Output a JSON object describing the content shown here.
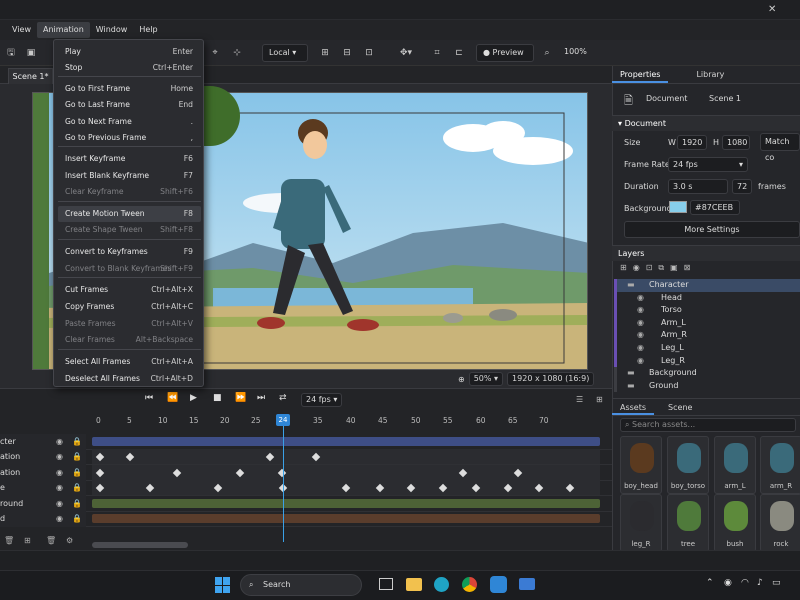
{
  "menubar": {
    "items": [
      "View",
      "Animation",
      "Window",
      "Help"
    ],
    "active": "Animation"
  },
  "toolbar": {
    "space_select": "Local",
    "preview_label": "Preview",
    "zoom": "100%"
  },
  "scene_tab": "Scene 1*",
  "canvas": {
    "zoom": "50%",
    "resolution": "1920 x 1080 (16:9)"
  },
  "animation_menu": {
    "items": [
      {
        "label": "Play",
        "shortcut": "Enter",
        "disabled": false
      },
      {
        "label": "Stop",
        "shortcut": "Ctrl+Enter",
        "disabled": false
      },
      {
        "label": "Go to First Frame",
        "shortcut": "Home",
        "disabled": false
      },
      {
        "label": "Go to Last Frame",
        "shortcut": "End",
        "disabled": false
      },
      {
        "label": "Go to Next Frame",
        "shortcut": ".",
        "disabled": false
      },
      {
        "label": "Go to Previous Frame",
        "shortcut": ",",
        "disabled": false
      },
      {
        "label": "Insert Keyframe",
        "shortcut": "F6",
        "disabled": false
      },
      {
        "label": "Insert Blank Keyframe",
        "shortcut": "F7",
        "disabled": false
      },
      {
        "label": "Clear Keyframe",
        "shortcut": "Shift+F6",
        "disabled": true
      },
      {
        "label": "Create Motion Tween",
        "shortcut": "F8",
        "disabled": false,
        "highlighted": true
      },
      {
        "label": "Create Shape Tween",
        "shortcut": "Shift+F8",
        "disabled": true
      },
      {
        "label": "Convert to Keyframes",
        "shortcut": "F9",
        "disabled": false
      },
      {
        "label": "Convert to Blank Keyframes",
        "shortcut": "Shift+F9",
        "disabled": true
      },
      {
        "label": "Cut Frames",
        "shortcut": "Ctrl+Alt+X",
        "disabled": false
      },
      {
        "label": "Copy Frames",
        "shortcut": "Ctrl+Alt+C",
        "disabled": false
      },
      {
        "label": "Paste Frames",
        "shortcut": "Ctrl+Alt+V",
        "disabled": true
      },
      {
        "label": "Clear Frames",
        "shortcut": "Alt+Backspace",
        "disabled": true
      },
      {
        "label": "Select All Frames",
        "shortcut": "Ctrl+Alt+A",
        "disabled": false
      },
      {
        "label": "Deselect All Frames",
        "shortcut": "Ctrl+Alt+D",
        "disabled": false
      }
    ]
  },
  "properties": {
    "tabs": [
      "Properties",
      "Library"
    ],
    "doc_label": "Document",
    "doc_name": "Scene 1",
    "section": "Document",
    "size_label": "Size",
    "width_prefix": "W",
    "width": "1920",
    "height_prefix": "H",
    "height": "1080",
    "match_btn": "Match co",
    "frame_rate_label": "Frame Rate",
    "frame_rate": "24 fps",
    "duration_label": "Duration",
    "duration": "3.0 s",
    "frames_count": "72",
    "frames_unit": "frames",
    "background_label": "Background",
    "background_hex": "#87CEEB",
    "more_settings": "More Settings"
  },
  "layers_panel": {
    "title": "Layers",
    "items": [
      {
        "name": "Character",
        "type": "folder",
        "selected": true
      },
      {
        "name": "Head",
        "type": "layer"
      },
      {
        "name": "Torso",
        "type": "layer"
      },
      {
        "name": "Arm_L",
        "type": "layer"
      },
      {
        "name": "Arm_R",
        "type": "layer"
      },
      {
        "name": "Leg_L",
        "type": "layer"
      },
      {
        "name": "Leg_R",
        "type": "layer"
      },
      {
        "name": "Background",
        "type": "folder"
      },
      {
        "name": "Ground",
        "type": "folder"
      }
    ]
  },
  "assets_panel": {
    "tabs": [
      "Assets",
      "Scene"
    ],
    "search_placeholder": "Search assets...",
    "items": [
      "boy_head",
      "boy_torso",
      "arm_L",
      "arm_R",
      "leg_R",
      "tree",
      "bush",
      "rock"
    ]
  },
  "timeline": {
    "fps": "24 fps",
    "ticks": [
      "0",
      "5",
      "10",
      "15",
      "20",
      "25",
      "24",
      "35",
      "40",
      "45",
      "50",
      "55",
      "60",
      "65",
      "70"
    ],
    "current_frame": "24",
    "rows": [
      "cter",
      "ation",
      "ation",
      "e",
      "round",
      "d"
    ]
  },
  "taskbar": {
    "search_label": "Search"
  },
  "colors": {
    "accent": "#4a90e2",
    "background_swatch": "#87CEEB"
  }
}
